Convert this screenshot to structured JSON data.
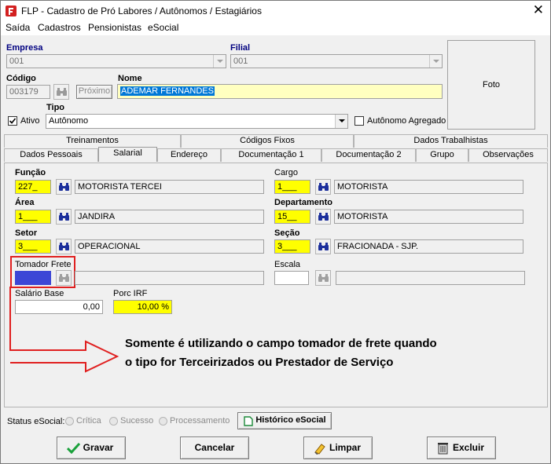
{
  "window": {
    "title": "FLP - Cadastro de Pró Labores / Autônomos / Estagiários"
  },
  "menu": {
    "items": [
      "Saída",
      "Cadastros",
      "Pensionistas",
      "eSocial"
    ]
  },
  "header": {
    "empresa_label": "Empresa",
    "empresa_value": "001",
    "filial_label": "Filial",
    "filial_value": "001",
    "codigo_label": "Código",
    "codigo_value": "003179",
    "proximo_label": "Próximo",
    "nome_label": "Nome",
    "nome_value": "ADEMAR FERNANDES",
    "tipo_label": "Tipo",
    "ativo_label": "Ativo",
    "ativo_checked": true,
    "tipo_value": "Autônomo",
    "autonomo_agregado_label": "Autônomo Agregado",
    "autonomo_agregado_checked": false,
    "foto_label": "Foto"
  },
  "tabs": {
    "row1": [
      "Treinamentos",
      "Códigos Fixos",
      "Dados Trabalhistas"
    ],
    "row2": [
      "Dados Pessoais",
      "Salarial",
      "Endereço",
      "Documentação 1",
      "Documentação 2",
      "Grupo",
      "Observações"
    ],
    "active": "Salarial"
  },
  "salarial": {
    "funcao_label": "Função",
    "funcao_code": "227_",
    "funcao_desc": "MOTORISTA TERCEI",
    "cargo_label": "Cargo",
    "cargo_code": "1___",
    "cargo_desc": "MOTORISTA",
    "area_label": "Área",
    "area_code": "1___",
    "area_desc": "JANDIRA",
    "departamento_label": "Departamento",
    "departamento_code": "15__",
    "departamento_desc": "MOTORISTA",
    "setor_label": "Setor",
    "setor_code": "3___",
    "setor_desc": "OPERACIONAL",
    "secao_label": "Seção",
    "secao_code": "3___",
    "secao_desc": "FRACIONADA - SJP.",
    "tomador_frete_label": "Tomador Frete",
    "escala_label": "Escala",
    "salario_base_label": "Salário Base",
    "salario_base_value": "0,00",
    "porc_irf_label": "Porc IRF",
    "porc_irf_value": "10,00 %"
  },
  "annotation": {
    "line1": "Somente é utilizando o campo tomador de frete quando",
    "line2": "o tipo for Terceirizados ou Prestador de Serviço"
  },
  "status": {
    "label": "Status eSocial:",
    "options": [
      "Crítica",
      "Sucesso",
      "Processamento"
    ],
    "historico_label": "Histórico eSocial"
  },
  "buttons": {
    "gravar": "Gravar",
    "cancelar": "Cancelar",
    "limpar": "Limpar",
    "excluir": "Excluir"
  },
  "colors": {
    "required_field": "#ffff00",
    "selection": "#0078d7",
    "tomador_fill": "#3c46d6",
    "annotation_red": "#e02020"
  }
}
